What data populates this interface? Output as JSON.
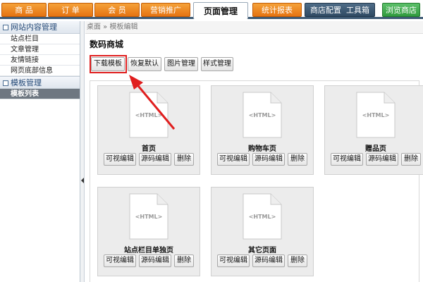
{
  "top_nav": {
    "tabs": [
      {
        "label": "商 品"
      },
      {
        "label": "订 单"
      },
      {
        "label": "会 员"
      },
      {
        "label": "营销推广"
      },
      {
        "label": "页面管理",
        "active": true
      },
      {
        "label": "统计报表"
      }
    ],
    "store_config_label": "商店配置",
    "toolbox_label": "工具箱",
    "browse_store_label": "浏览商店"
  },
  "sidebar": {
    "sections": [
      {
        "title": "网站内容管理",
        "items": [
          "站点栏目",
          "文章管理",
          "友情链接",
          "网页底部信息"
        ]
      },
      {
        "title": "模板管理",
        "items": [
          "模板列表"
        ],
        "selected": "模板列表"
      }
    ]
  },
  "breadcrumb": "桌面 » 模板编辑",
  "page_title": "数码商城",
  "toolbar": {
    "download_template": "下载模板",
    "restore_default": "恢复默认",
    "image_manage": "图片管理",
    "style_manage": "样式管理"
  },
  "templates": [
    {
      "title": "首页"
    },
    {
      "title": "购物车页"
    },
    {
      "title": "赠品页"
    },
    {
      "title": "站点栏目单独页"
    },
    {
      "title": "其它页面"
    }
  ],
  "card_buttons": {
    "visual_edit": "可视编辑",
    "source_edit": "源码编辑",
    "delete": "删除"
  },
  "doc_icon_label": "<HTML>",
  "colors": {
    "nav_orange": "#e57311",
    "nav_dark": "#2f4a63",
    "nav_green": "#2f9a3d",
    "highlight_red": "#e01e1e",
    "selected_item": "#6e7781"
  }
}
